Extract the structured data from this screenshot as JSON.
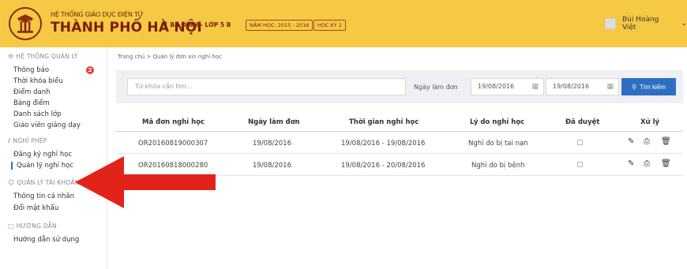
{
  "header": {
    "brand_top": "HỆ THỐNG GIÁO DỤC ĐIỆN TỬ",
    "brand_main": "THÀNH PHỐ HÀ NỘI",
    "location": "BA ĐÌNH - LỚP 5 B",
    "school_year": "NĂM HỌC: 2015 - 2016",
    "semester": "HỌC KỲ 2",
    "user_name": "Bùi Hoàng Việt",
    "accent": "#f6c945"
  },
  "sidebar": {
    "sections": [
      {
        "title": "HỆ THỐNG QUẢN LÝ",
        "items": [
          "Thông báo",
          "Thời khóa biểu",
          "Điểm danh",
          "Bảng điểm",
          "Danh sách lớp",
          "Giáo viên giảng dạy"
        ]
      },
      {
        "title": "NGHỈ PHÉP",
        "items": [
          "Đăng ký nghỉ học",
          "Quản lý nghỉ học"
        ]
      },
      {
        "title": "QUẢN LÝ TÀI KHOẢN",
        "items": [
          "Thông tin cá nhân",
          "Đổi mật khẩu"
        ]
      },
      {
        "title": "HƯỚNG DẪN",
        "items": [
          "Hướng dẫn sử dụng"
        ]
      }
    ],
    "notification_count": "2",
    "active_item": "Quản lý nghỉ học"
  },
  "breadcrumb": "Trang chủ > Quản lý đơn xin nghỉ học",
  "filters": {
    "search_placeholder": "Từ khóa cần tìm...",
    "date_label": "Ngày làm đơn",
    "date_from": "19/08/2016",
    "date_to": "19/08/2016",
    "search_button": "Tìm kiếm"
  },
  "table": {
    "columns": [
      "Mã đơn nghỉ học",
      "Ngày làm đơn",
      "Thời gian nghỉ học",
      "Lý do nghỉ học",
      "Đã duyệt",
      "Xử lý"
    ],
    "rows": [
      {
        "id": "OR20160819000307",
        "date": "19/08/2016",
        "period": "19/08/2016 - 19/08/2016",
        "reason": "Nghỉ do bị tai nạn"
      },
      {
        "id": "OR20160818000280",
        "date": "19/08/2016",
        "period": "19/08/2016 - 20/08/2016",
        "reason": "Nghỉ do bị bệnh"
      }
    ]
  }
}
